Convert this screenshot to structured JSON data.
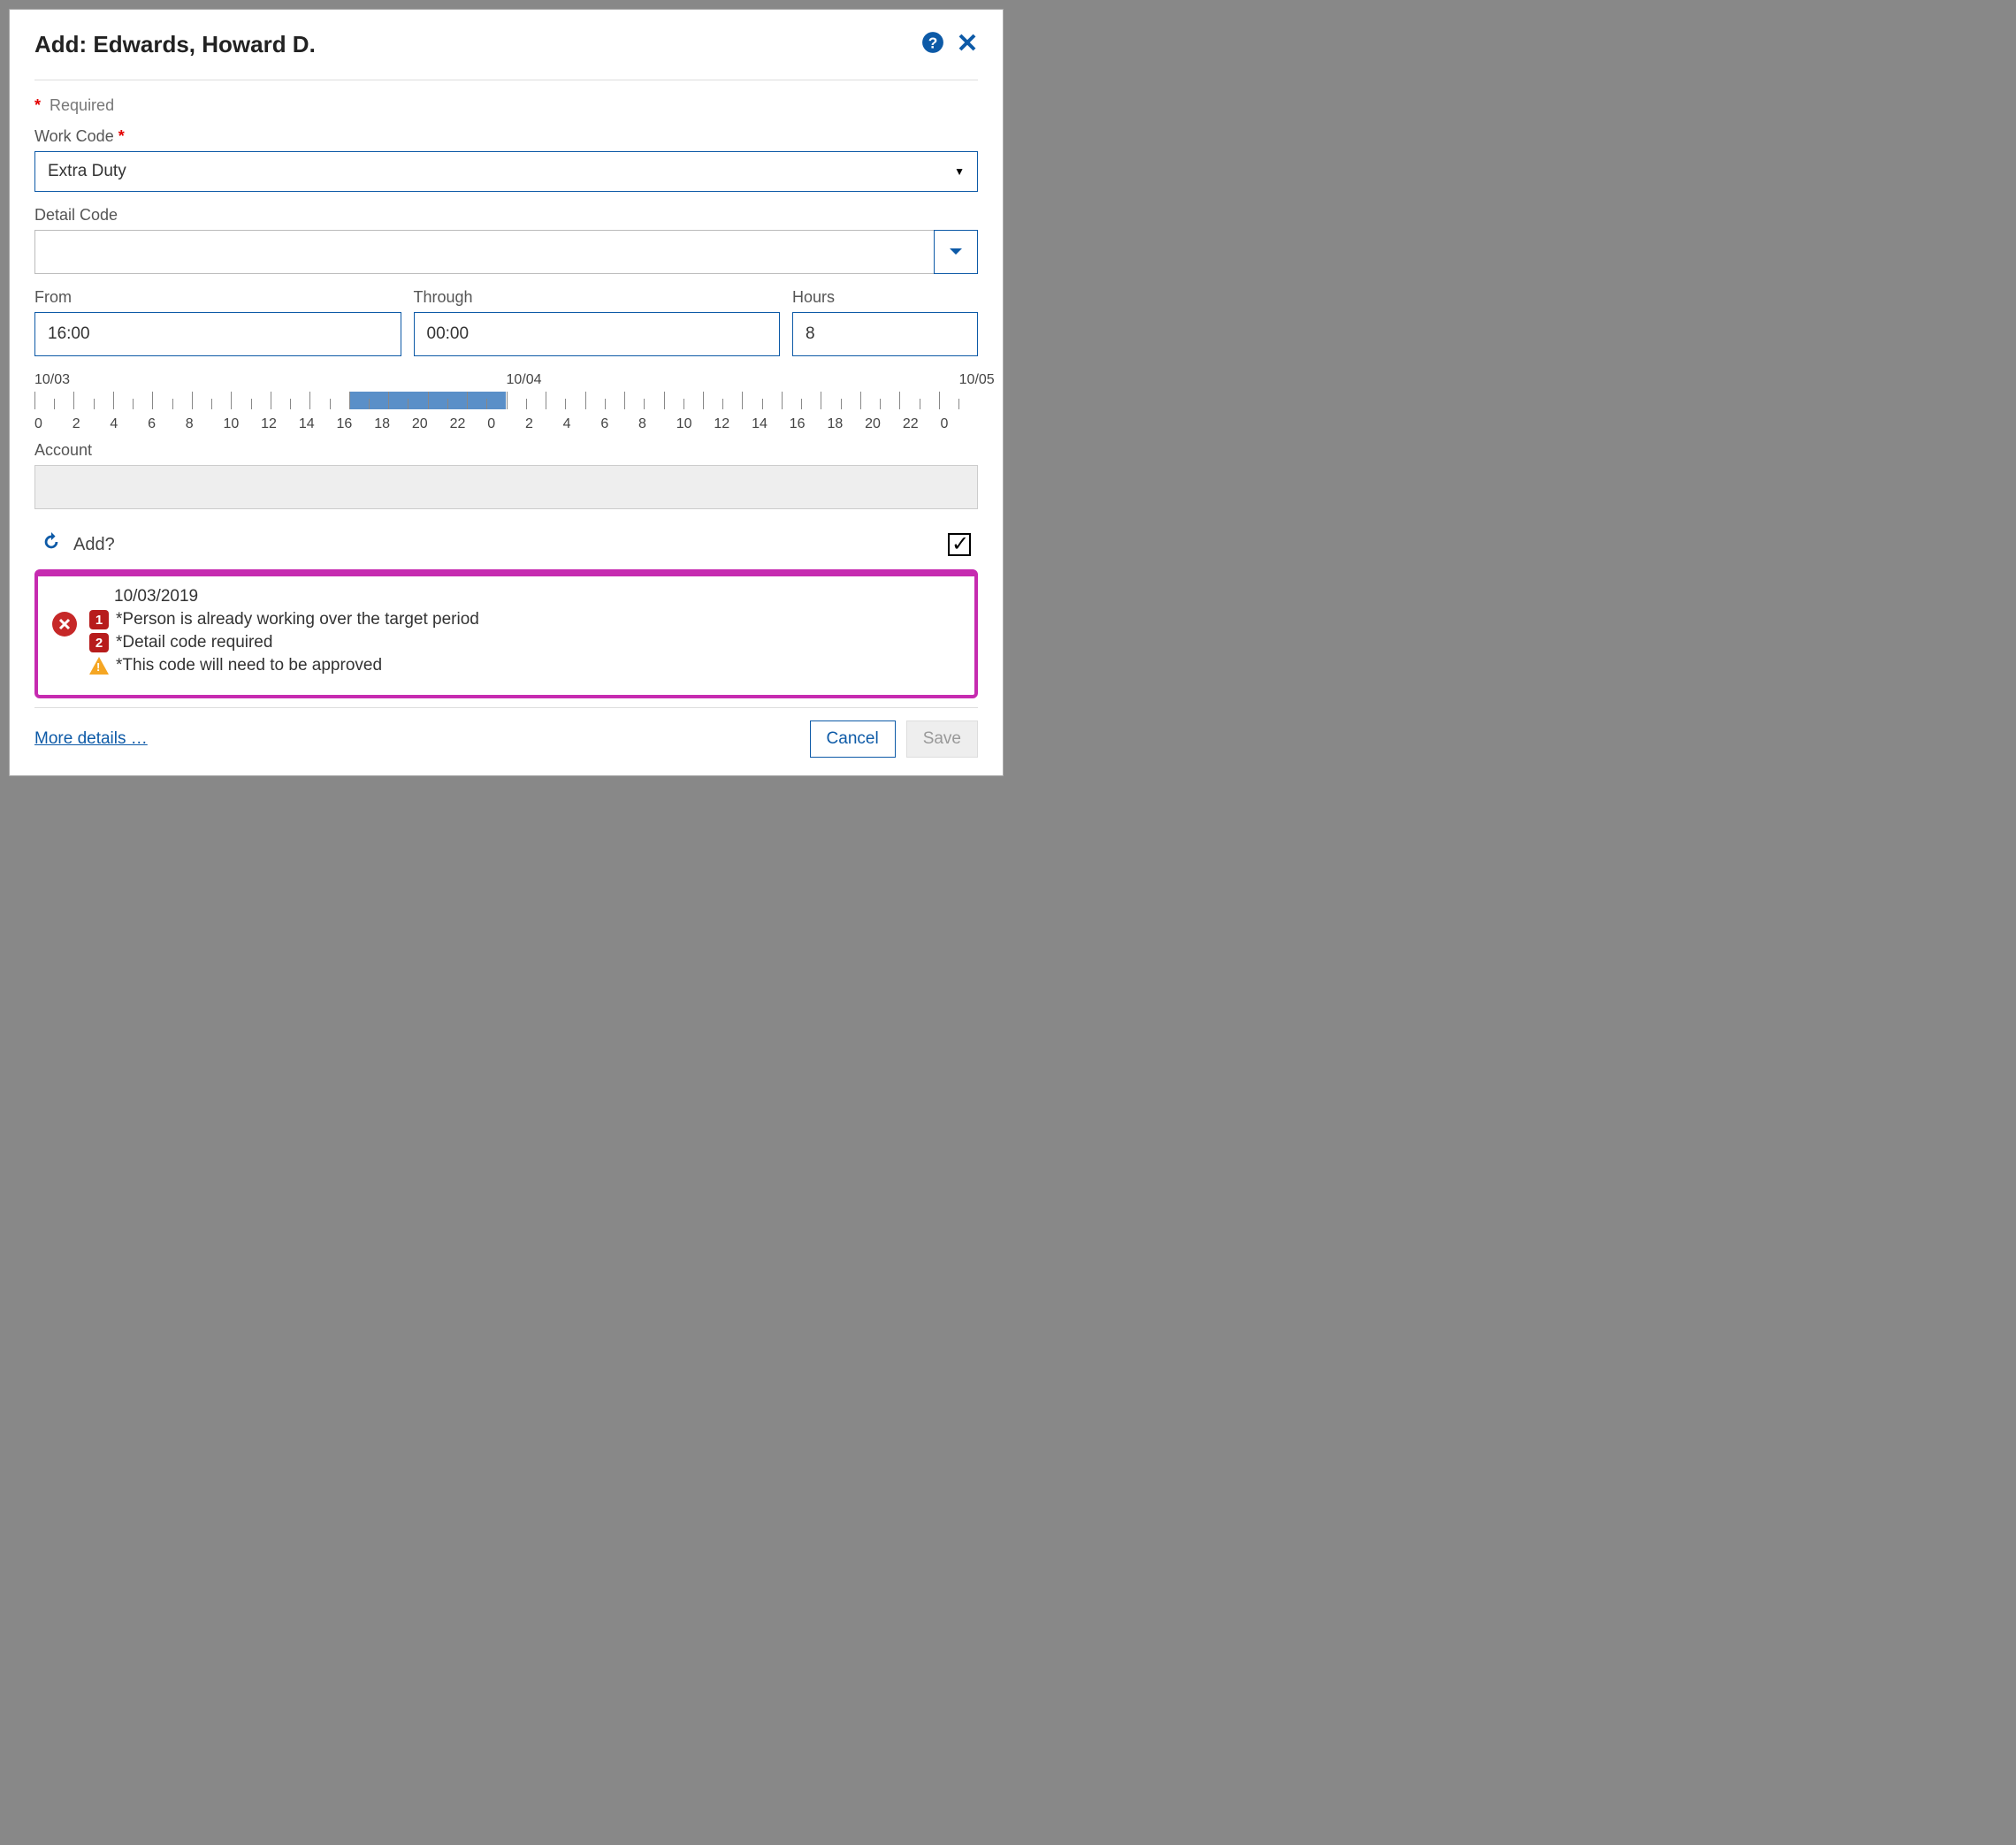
{
  "header": {
    "title": "Add: Edwards, Howard D."
  },
  "required_label": "Required",
  "fields": {
    "work_code": {
      "label": "Work Code",
      "value": "Extra Duty"
    },
    "detail_code": {
      "label": "Detail Code",
      "value": ""
    },
    "from": {
      "label": "From",
      "value": "16:00"
    },
    "through": {
      "label": "Through",
      "value": "00:00"
    },
    "hours": {
      "label": "Hours",
      "value": "8"
    },
    "account": {
      "label": "Account",
      "value": ""
    }
  },
  "timeline": {
    "dates": [
      "10/03",
      "10/04",
      "10/05"
    ],
    "hours": [
      "0",
      "2",
      "4",
      "6",
      "8",
      "10",
      "12",
      "14",
      "16",
      "18",
      "20",
      "22",
      "0",
      "2",
      "4",
      "6",
      "8",
      "10",
      "12",
      "14",
      "16",
      "18",
      "20",
      "22",
      "0"
    ]
  },
  "add_row": {
    "label": "Add?",
    "checked": true
  },
  "validation": {
    "date": "10/03/2019",
    "items": [
      {
        "badge": "1",
        "text": "*Person is already working over the target period"
      },
      {
        "badge": "2",
        "text": "*Detail code required"
      },
      {
        "badge": "warn",
        "text": "*This code will need to be approved"
      }
    ]
  },
  "footer": {
    "more": "More details …",
    "cancel": "Cancel",
    "save": "Save"
  }
}
